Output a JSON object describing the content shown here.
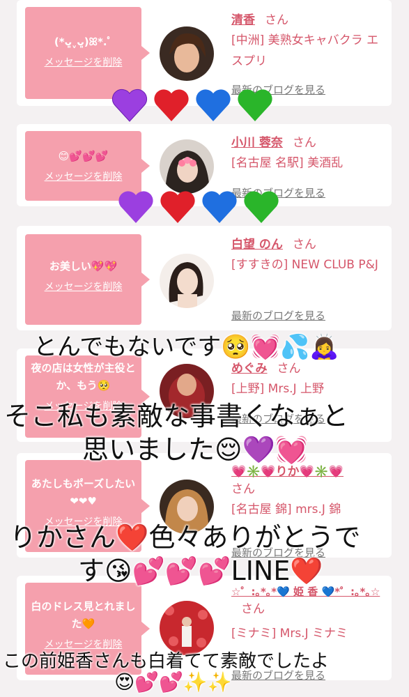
{
  "colors": {
    "pink": "#f5a0ad",
    "name_red": "#d5566a",
    "link_gray": "#777777",
    "bg": "#f4f1f2"
  },
  "cards": [
    {
      "message": "(*ᴗ͈ˬᴗ͈)ꕤ*.ﾟ",
      "delete_label": "メッセージを削除",
      "name": "清香",
      "san": "さん",
      "shop": "[中洲] 美熟女キャバクラ エスプリ",
      "blog": "最新のブログを見る"
    },
    {
      "message": "😊💕💕💕",
      "delete_label": "メッセージを削除",
      "name": "小川 蓉奈",
      "san": "さん",
      "shop": "[名古屋 名駅] 美酒乱",
      "blog": "最新のブログを見る"
    },
    {
      "message": "お美しい💖💖",
      "delete_label": "メッセージを削除",
      "name": "白望 のん",
      "san": "さん",
      "shop": "[すすきの] NEW CLUB P&J",
      "blog": "最新のブログを見る"
    },
    {
      "message": "夜の店は女性が主役とか、もう🥺",
      "delete_label": "メッセージを削除",
      "name": "めぐみ",
      "san": "さん",
      "shop": "[上野] Mrs.J 上野",
      "blog": "最新のブログを見る"
    },
    {
      "message": "あたしもポーズしたい❤❤♥",
      "delete_label": "メッセージを削除",
      "name": "💗✳️💗りか💗✳️💗",
      "san": "さん",
      "shop": "[名古屋 錦] mrs.J 錦",
      "blog": "最新のブログを見る"
    },
    {
      "message": "白のドレス見とれました🧡",
      "delete_label": "メッセージを削除",
      "name": "☆゜:｡*｡*💙 姫 香 💙*゜:｡*｡☆",
      "san": "さん",
      "shop": "[ミナミ] Mrs.J ミナミ",
      "blog": "最新のブログを見る"
    }
  ],
  "overlay": {
    "line1": "とんでもないです🥺💓💦🙇‍♀️",
    "line2": "そこ私も素敵な事書くなぁと",
    "line3": "思いました😌💜💓",
    "line4": "りかさん❤️色々ありがとうで",
    "line5": "す😘💕💕💕LINE❤️",
    "line6": "この前姫香さんも白着てて素敵でしたよ",
    "line7": "😍💕💕✨✨"
  }
}
